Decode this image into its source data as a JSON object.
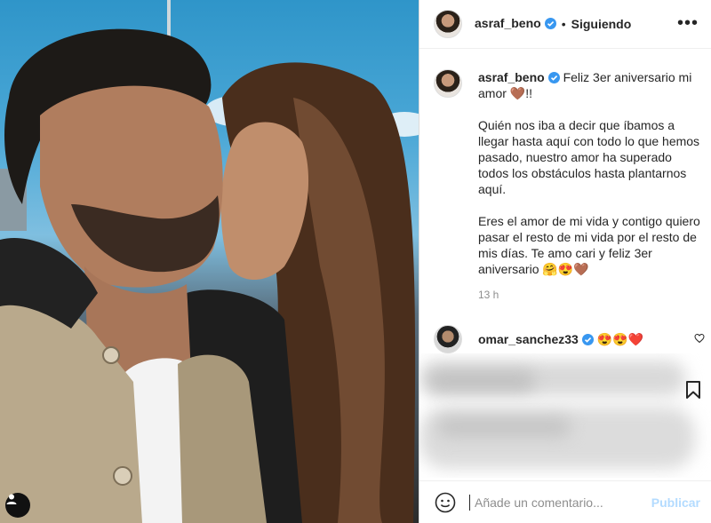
{
  "header": {
    "username": "asraf_beno",
    "separator": "•",
    "follow_status": "Siguiendo",
    "more_label": "•••"
  },
  "caption": {
    "username": "asraf_beno",
    "text": "Feliz 3er aniversario mi amor 🤎!!\n\nQuién nos iba a decir que íbamos a llegar hasta aquí con todo lo que hemos pasado, nuestro amor ha superado todos los obstáculos hasta plantarnos aquí.\n\nEres el amor de mi vida y contigo quiero pasar el resto de mi vida por el resto de mis días. Te amo cari y feliz 3er aniversario 🤗😍🤎",
    "time": "13 h"
  },
  "comment": {
    "username": "omar_sanchez33",
    "text": "😍😍❤️"
  },
  "add_comment": {
    "placeholder": "Añade un comentario...",
    "publish_label": "Publicar"
  },
  "colors": {
    "verified": "#3897f0",
    "publish_disabled": "#b3dbff",
    "meta_text": "#8e8e8e"
  },
  "icons": [
    "verified-icon",
    "more-icon",
    "heart-icon",
    "bookmark-icon",
    "emoji-icon",
    "user-tag-icon"
  ]
}
